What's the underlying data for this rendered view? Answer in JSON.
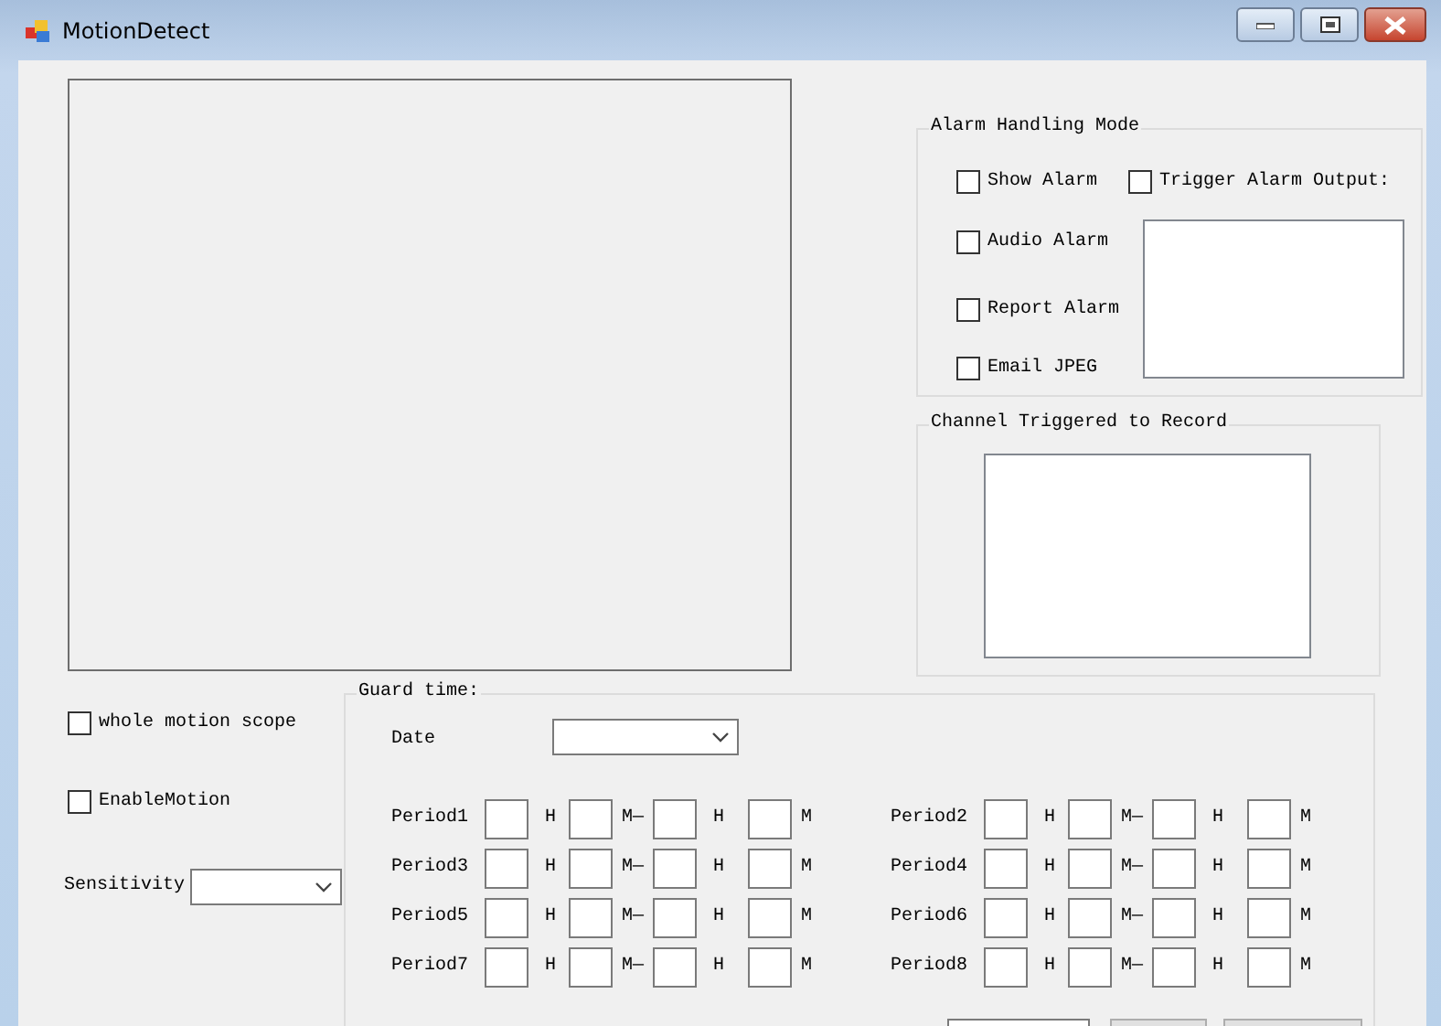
{
  "window": {
    "title": "MotionDetect"
  },
  "alarm_group": {
    "title": "Alarm Handling Mode",
    "options": [
      {
        "label": "Show Alarm",
        "checked": false
      },
      {
        "label": "Trigger Alarm Output:",
        "checked": false
      },
      {
        "label": "Audio Alarm",
        "checked": false
      },
      {
        "label": "Report Alarm",
        "checked": false
      },
      {
        "label": "Email JPEG",
        "checked": false
      }
    ]
  },
  "record_group": {
    "title": "Channel Triggered to Record"
  },
  "motion_options": [
    {
      "label": "whole motion scope",
      "checked": false
    },
    {
      "label": "EnableMotion",
      "checked": false
    }
  ],
  "sensitivity": {
    "label": "Sensitivity"
  },
  "guard_group": {
    "title": "Guard time:",
    "date_label": "Date",
    "periods": [
      {
        "label": "Period1",
        "units": [
          "H",
          "M—",
          "H",
          "M"
        ]
      },
      {
        "label": "Period2",
        "units": [
          "H",
          "M—",
          "H",
          "M"
        ]
      },
      {
        "label": "Period3",
        "units": [
          "H",
          "M—",
          "H",
          "M"
        ]
      },
      {
        "label": "Period4",
        "units": [
          "H",
          "M—",
          "H",
          "M"
        ]
      },
      {
        "label": "Period5",
        "units": [
          "H",
          "M—",
          "H",
          "M"
        ]
      },
      {
        "label": "Period6",
        "units": [
          "H",
          "M—",
          "H",
          "M"
        ]
      },
      {
        "label": "Period7",
        "units": [
          "H",
          "M—",
          "H",
          "M"
        ]
      },
      {
        "label": "Period8",
        "units": [
          "H",
          "M—",
          "H",
          "M"
        ]
      }
    ]
  }
}
